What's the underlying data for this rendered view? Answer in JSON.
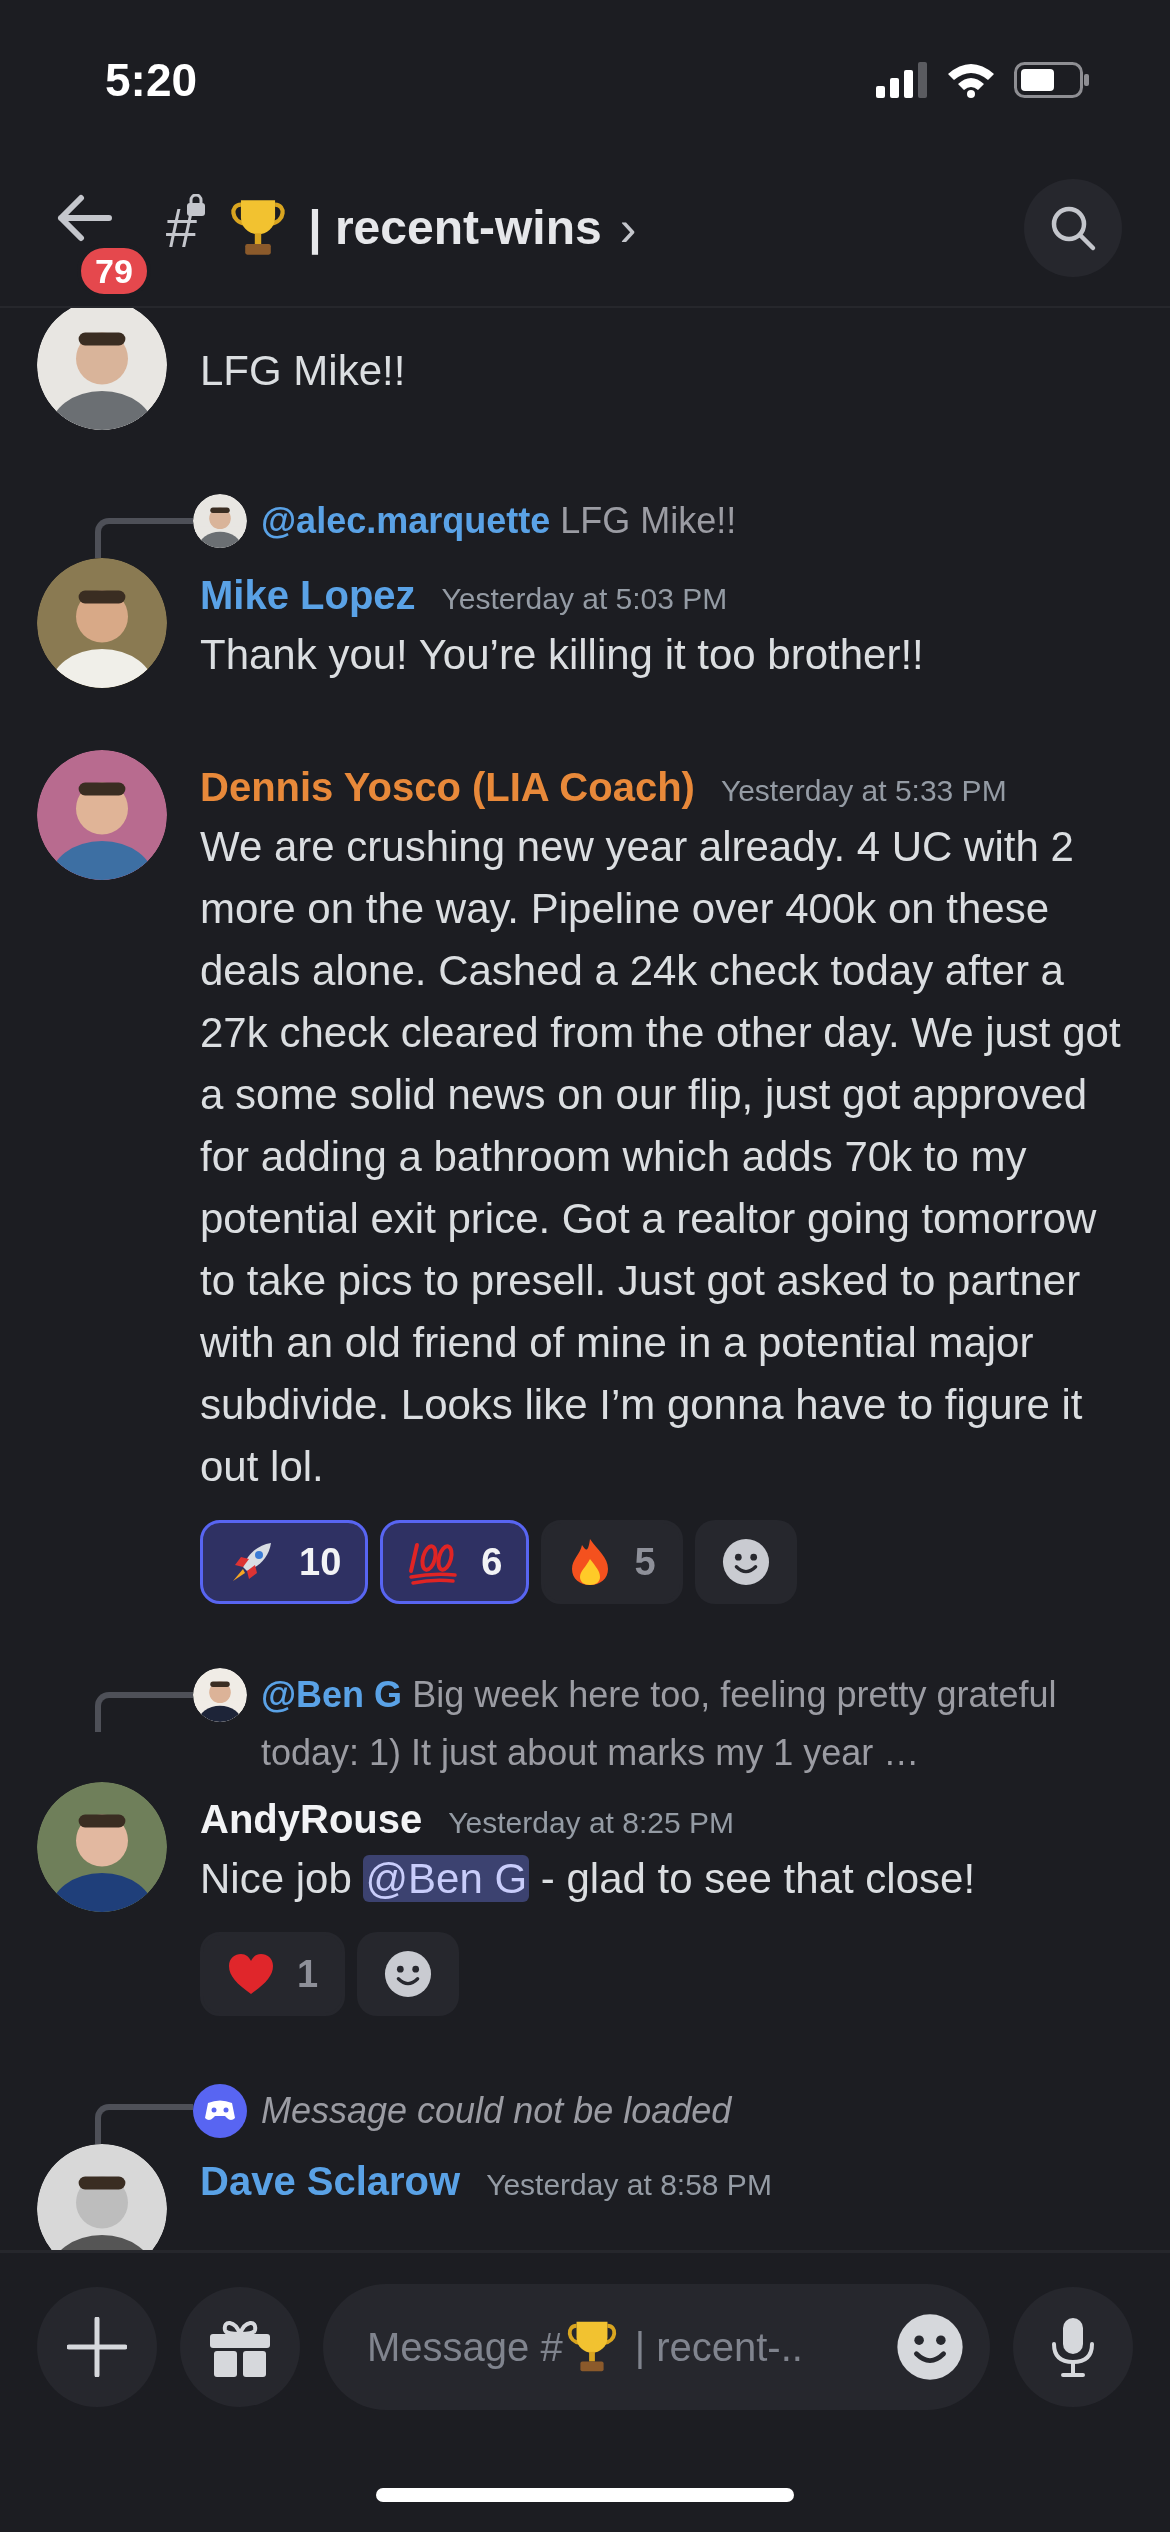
{
  "status_bar": {
    "time": "5:20"
  },
  "header": {
    "unread_badge": "79",
    "channel_symbol": "#",
    "channel_name": "| recent-wins",
    "chevron": "›"
  },
  "messages": [
    {
      "body": "LFG Mike!!"
    },
    {
      "reply": {
        "kind": "user",
        "mention": "@alec.marquette",
        "text": "LFG Mike!!"
      },
      "author": {
        "name": "Mike Lopez",
        "color": "#5aa2e6"
      },
      "time": "Yesterday at 5:03 PM",
      "body": "Thank you! You’re killing it too brother!!"
    },
    {
      "author": {
        "name": "Dennis Yosco (LIA Coach)",
        "color": "#e8893a"
      },
      "time": "Yesterday at 5:33 PM",
      "body": "We are crushing new year already. 4 UC with 2 more on the way. Pipeline over 400k on these deals alone. Cashed a 24k check today after a 27k check cleared from the other day. We just got a some solid news on our flip, just got approved for adding a bathroom which adds 70k to my potential exit price. Got a realtor going tomorrow to take pics to presell. Just got asked to partner with an old friend of mine in a potential major subdivide. Looks like I’m gonna have to figure it out lol.",
      "reactions": [
        {
          "kind": "rocket",
          "count": "10",
          "selected": true
        },
        {
          "kind": "hundred",
          "count": "6",
          "selected": true
        },
        {
          "kind": "fire",
          "count": "5",
          "selected": false
        }
      ]
    },
    {
      "reply": {
        "kind": "user",
        "mention": "@Ben G",
        "text": "Big week here too, feeling pretty grateful today: 1) It just about marks my 1 year …"
      },
      "author": {
        "name": "AndyRouse",
        "color": "#f2f3f5"
      },
      "time": "Yesterday at 8:25 PM",
      "body_before": "Nice job ",
      "mention": "@Ben G",
      "body_after": " - glad to see that close!",
      "reactions": [
        {
          "kind": "heart",
          "count": "1",
          "selected": false
        }
      ]
    },
    {
      "reply": {
        "kind": "system",
        "text": "Message could not be loaded"
      },
      "author": {
        "name": "Dave Sclarow",
        "color": "#5aa2e6"
      },
      "time": "Yesterday at 8:58 PM"
    }
  ],
  "composer": {
    "placeholder_before": "Message #",
    "placeholder_after": "| recent-.."
  }
}
